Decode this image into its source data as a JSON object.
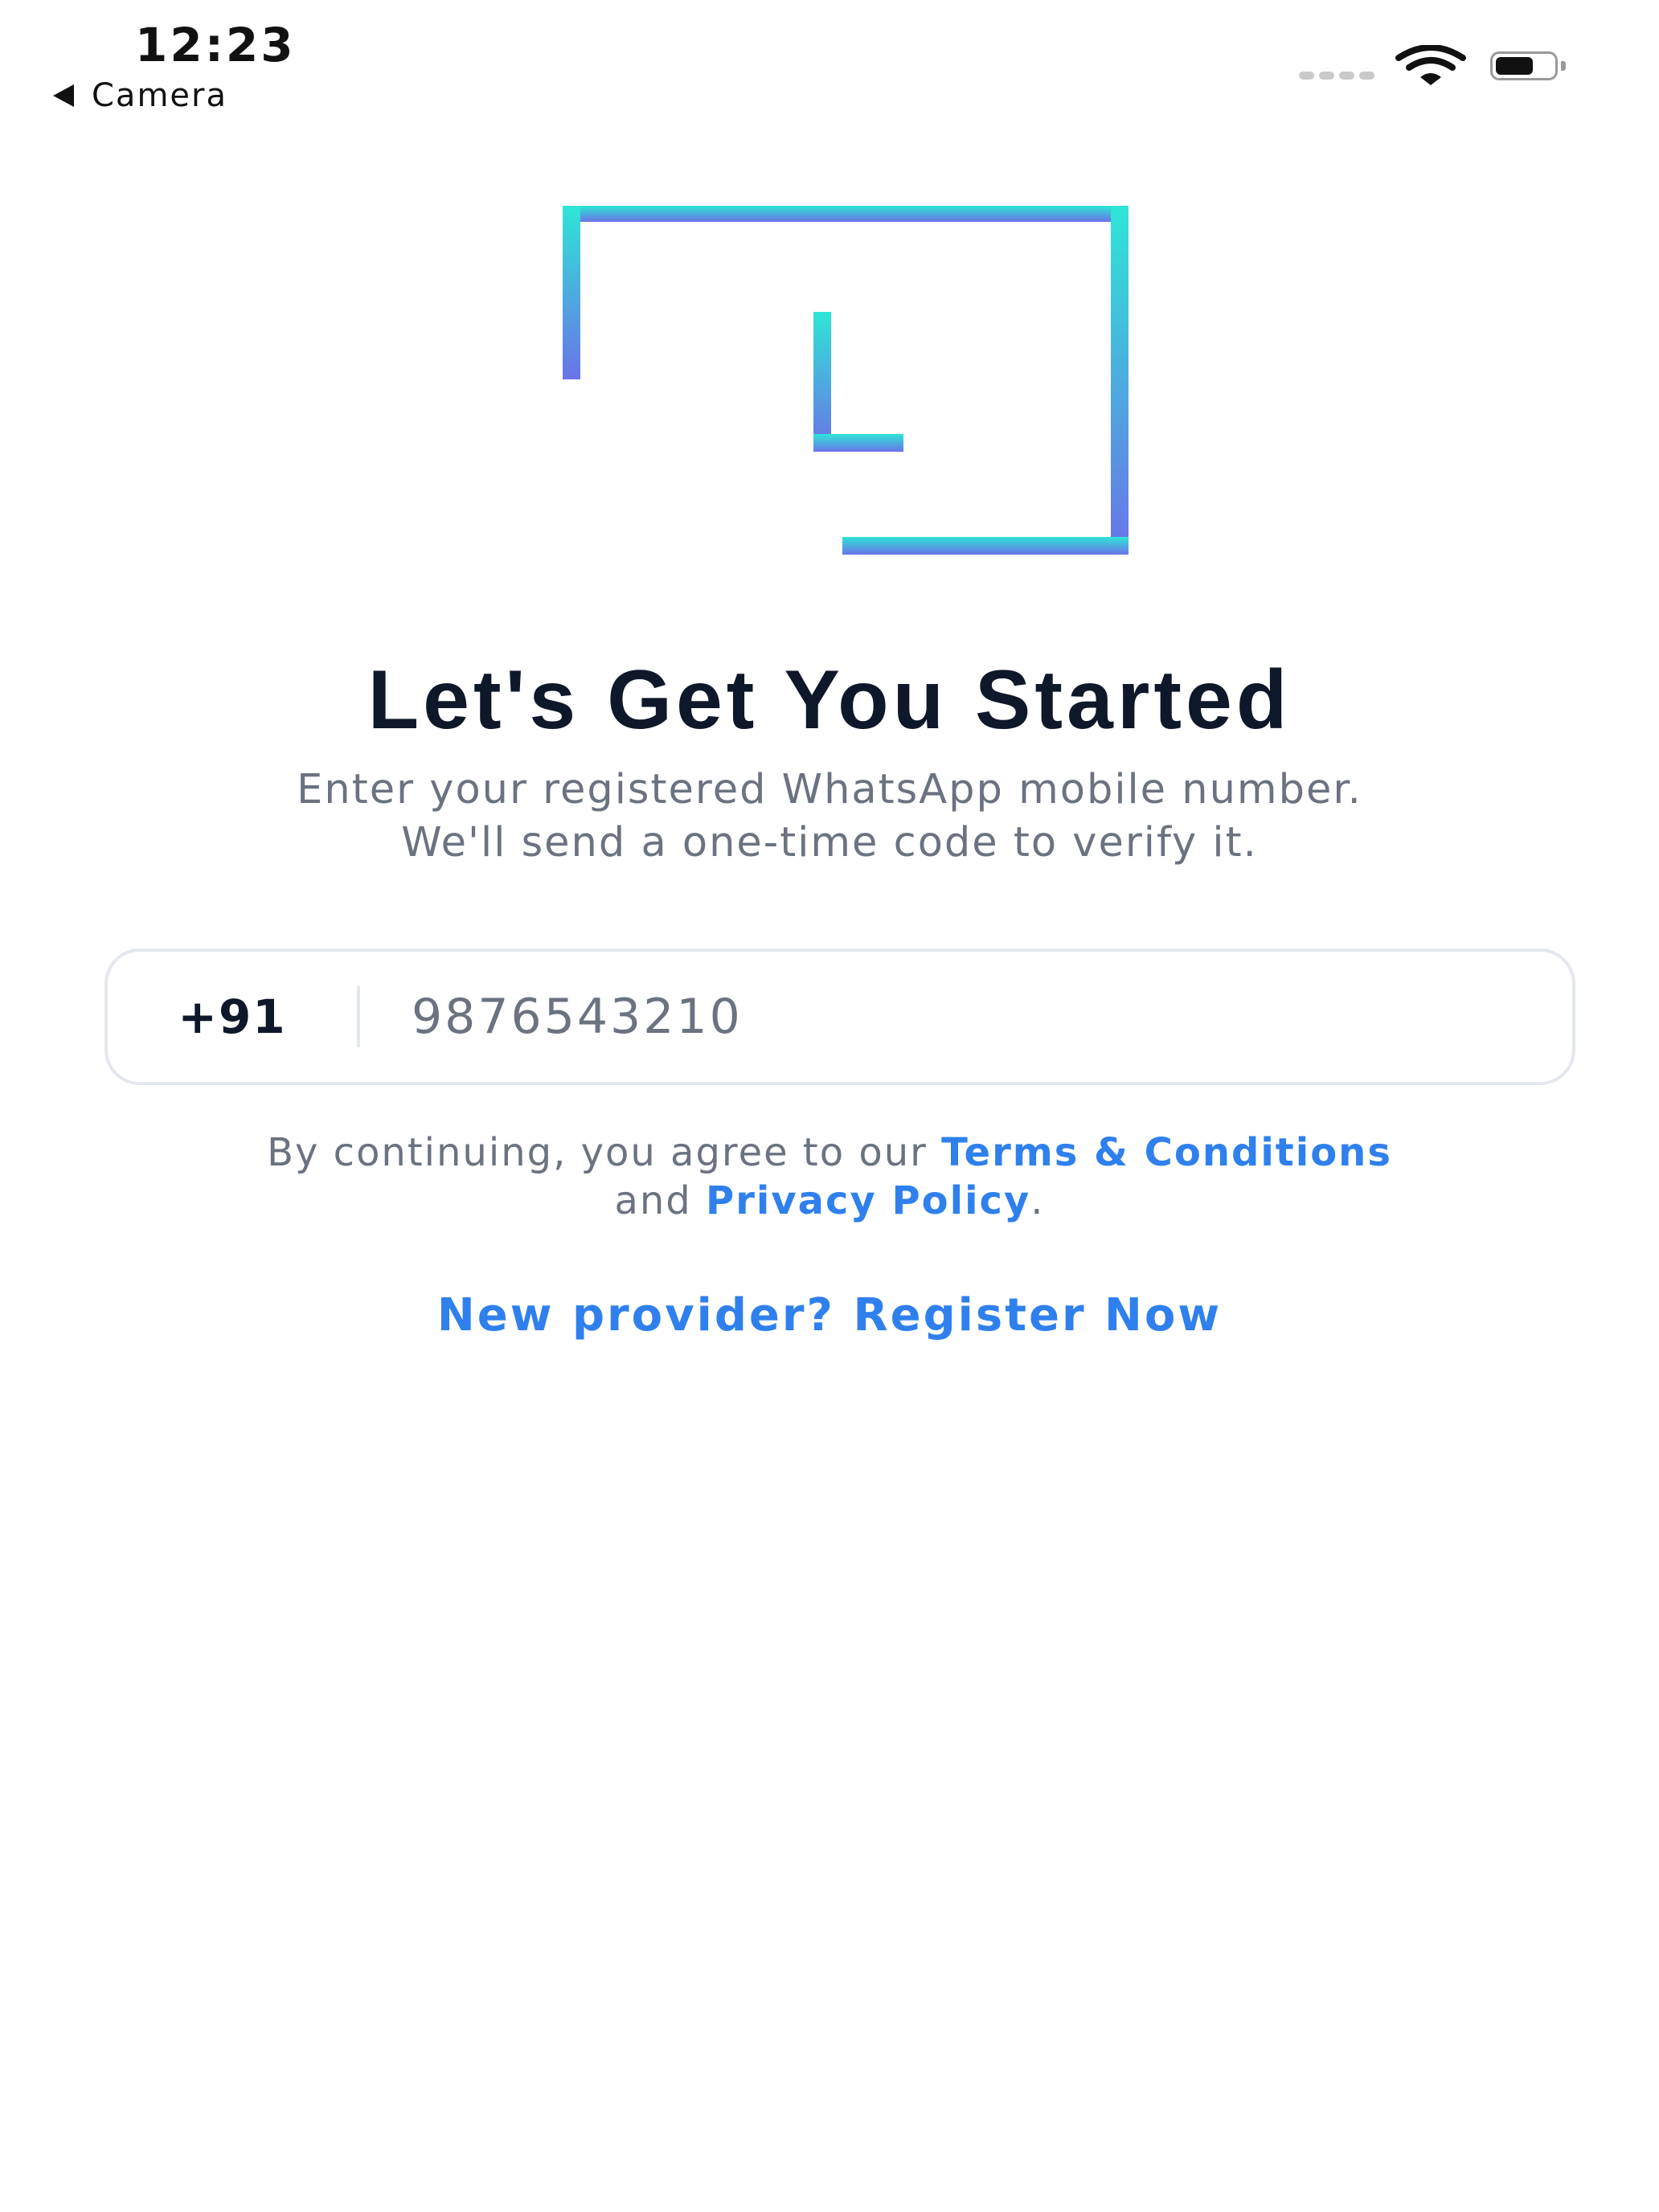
{
  "status_bar": {
    "time": "12:23",
    "back_label": "Camera",
    "icons": [
      "signal-dots-icon",
      "wifi-icon",
      "battery-icon"
    ]
  },
  "logo": {
    "letter": "L",
    "gradient_start": "#2ee6d6",
    "gradient_end": "#6a73e8"
  },
  "header": {
    "title": "Let's Get You Started",
    "subtitle_line1": "Enter your registered WhatsApp mobile number.",
    "subtitle_line2": "We'll send a one-time code to verify it."
  },
  "phone": {
    "country_code": "+91",
    "placeholder": "9876543210"
  },
  "terms": {
    "prefix": "By continuing, you agree to our ",
    "terms_link": "Terms & Conditions",
    "middle": "and ",
    "privacy_link": "Privacy Policy",
    "suffix": "."
  },
  "register": {
    "label": "New provider? Register Now"
  },
  "colors": {
    "title": "#0f172a",
    "muted_text": "#6b7280",
    "link": "#2f80ed",
    "input_border": "#e3e7ee"
  }
}
